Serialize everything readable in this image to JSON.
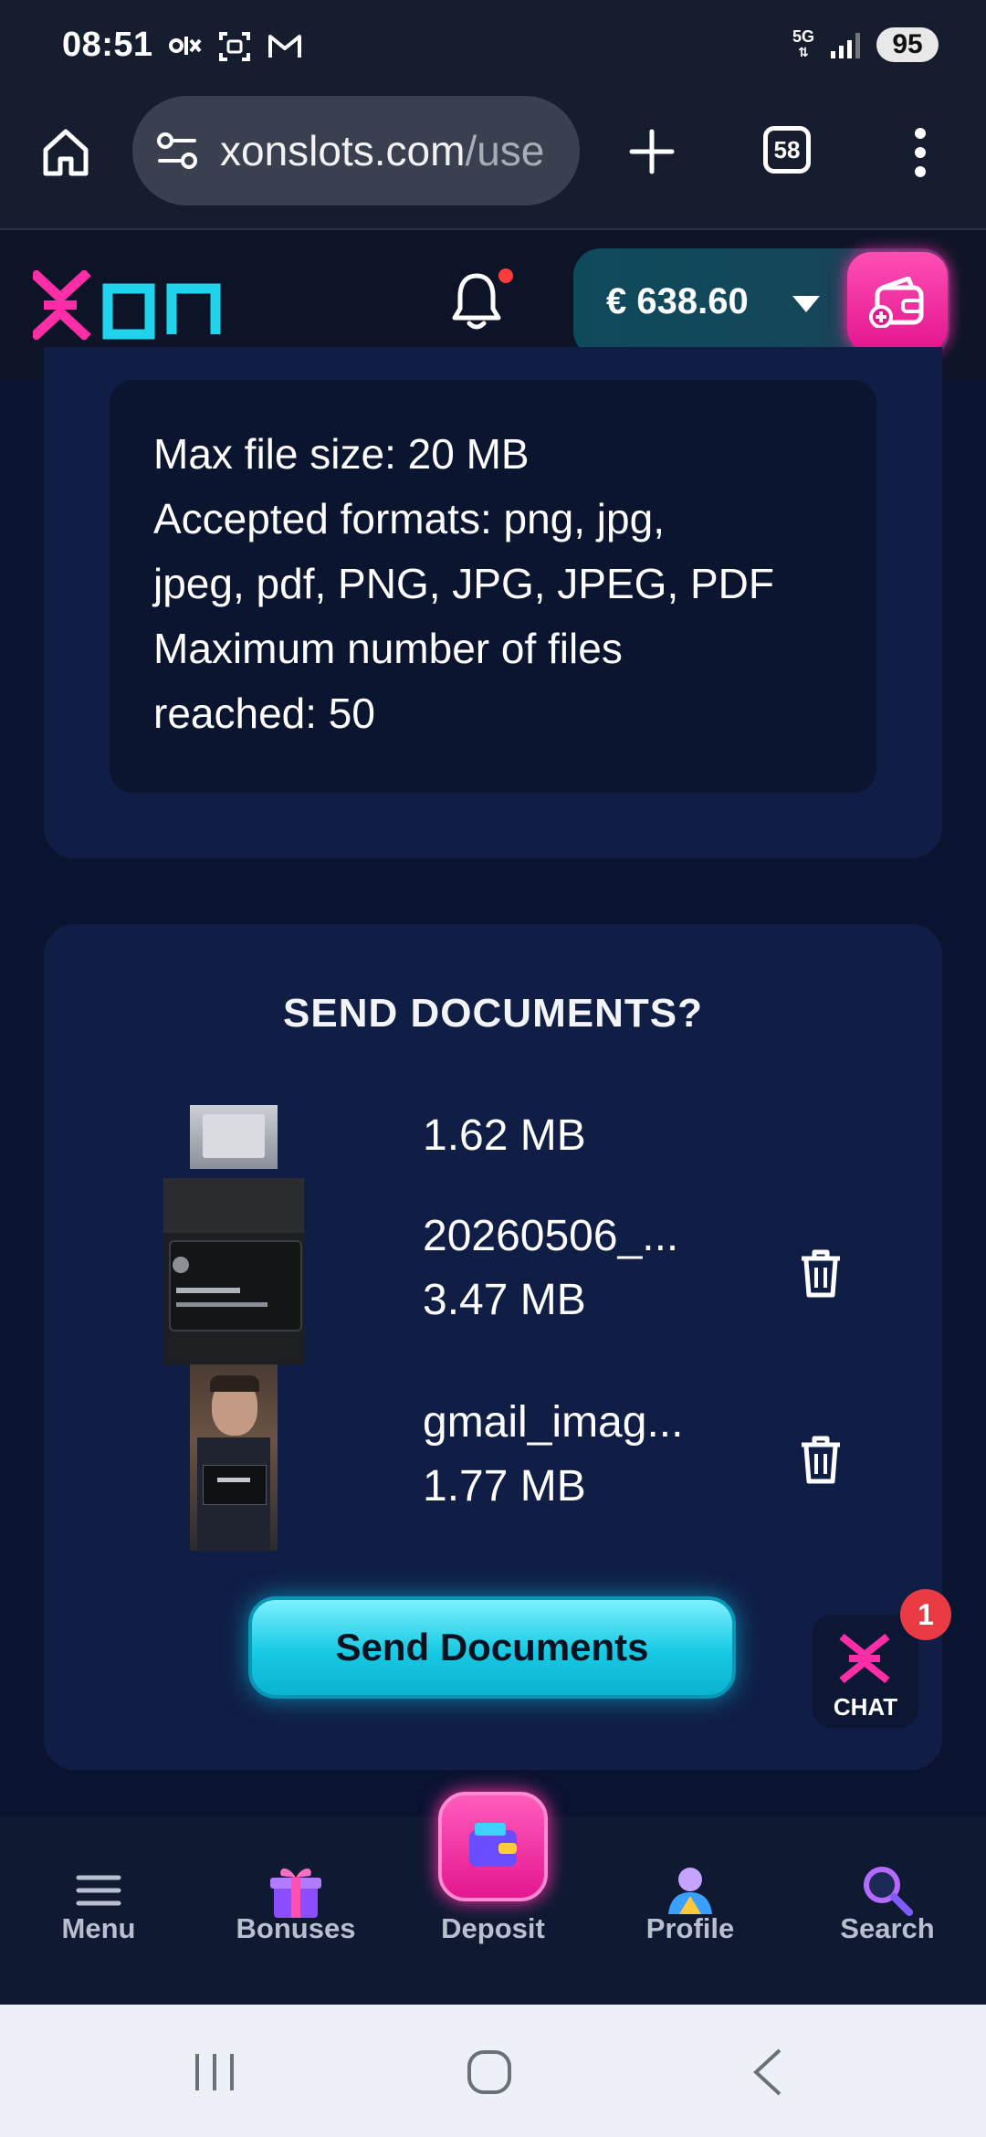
{
  "status_bar": {
    "time": "08:51",
    "network": "5G",
    "battery": "95",
    "left_icons": [
      "olx-icon",
      "screenshot-icon",
      "gmail-icon"
    ]
  },
  "browser": {
    "url_main": "xonslots.com",
    "url_rest": "/use",
    "tab_count": "58"
  },
  "site_header": {
    "balance": "€ 638.60",
    "notification_dot": true
  },
  "file_info": {
    "lines": [
      "Max file size: 20 MB",
      "Accepted formats: png, jpg,",
      "jpeg, pdf, PNG, JPG, JPEG, PDF",
      "Maximum number of files",
      "reached: 50"
    ]
  },
  "send_documents": {
    "title": "SEND DOCUMENTS?",
    "files": [
      {
        "name": "",
        "size": "1.62 MB"
      },
      {
        "name": "20260506_...",
        "size": "3.47 MB"
      },
      {
        "name": "gmail_imag...",
        "size": "1.77 MB"
      }
    ],
    "button_label": "Send Documents"
  },
  "chat": {
    "label": "CHAT",
    "badge": "1"
  },
  "bottom_nav": {
    "items": [
      {
        "label": "Menu",
        "icon": "menu-icon"
      },
      {
        "label": "Bonuses",
        "icon": "gift-icon"
      },
      {
        "label": "Deposit",
        "icon": "wallet-icon"
      },
      {
        "label": "Profile",
        "icon": "profile-icon"
      },
      {
        "label": "Search",
        "icon": "search-icon"
      }
    ]
  },
  "colors": {
    "accent_pink": "#ff1fa0",
    "accent_cyan": "#17c9e3",
    "background": "#0a1330",
    "card": "#101e45"
  }
}
